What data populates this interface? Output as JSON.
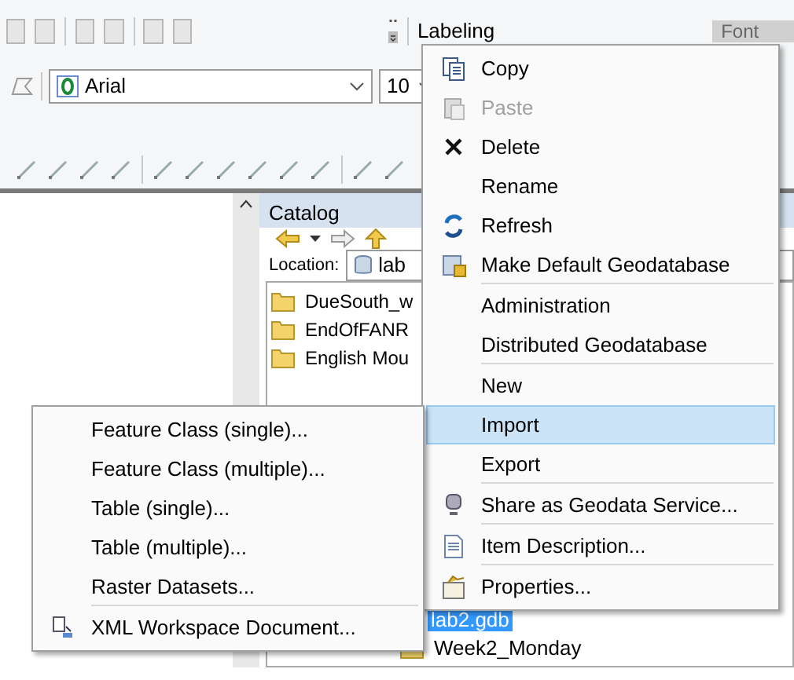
{
  "toolbar": {
    "labeling": "Labeling",
    "font_label": "Font",
    "font_name": "Arial",
    "font_size": "10"
  },
  "catalog": {
    "title": "Catalog",
    "location_label": "Location:",
    "location_value": "lab",
    "items": [
      {
        "label": "DueSouth_w",
        "selected": false
      },
      {
        "label": "EndOfFANR",
        "selected": false
      },
      {
        "label": "English Mou",
        "selected": false
      }
    ],
    "lower_items": [
      {
        "label": "lab2.gdb",
        "selected": true
      },
      {
        "label": "Week2_Monday",
        "selected": false
      }
    ]
  },
  "context_menu": [
    {
      "label": "Copy",
      "kind": "copy",
      "disabled": false,
      "selected": false,
      "divider": false
    },
    {
      "label": "Paste",
      "kind": "paste",
      "disabled": true,
      "selected": false,
      "divider": false
    },
    {
      "label": "Delete",
      "kind": "delete",
      "disabled": false,
      "selected": false,
      "divider": false
    },
    {
      "label": "Rename",
      "kind": "plain",
      "disabled": false,
      "selected": false,
      "divider": false
    },
    {
      "label": "Refresh",
      "kind": "refresh",
      "disabled": false,
      "selected": false,
      "divider": false
    },
    {
      "label": "Make Default Geodatabase",
      "kind": "database",
      "disabled": false,
      "selected": false,
      "divider": true
    },
    {
      "label": "Administration",
      "kind": "plain",
      "disabled": false,
      "selected": false,
      "divider": false
    },
    {
      "label": "Distributed Geodatabase",
      "kind": "plain",
      "disabled": false,
      "selected": false,
      "divider": true
    },
    {
      "label": "New",
      "kind": "plain",
      "disabled": false,
      "selected": false,
      "divider": false
    },
    {
      "label": "Import",
      "kind": "plain",
      "disabled": false,
      "selected": true,
      "divider": false
    },
    {
      "label": "Export",
      "kind": "plain",
      "disabled": false,
      "selected": false,
      "divider": true
    },
    {
      "label": "Share as Geodata Service...",
      "kind": "service",
      "disabled": false,
      "selected": false,
      "divider": true
    },
    {
      "label": "Item Description...",
      "kind": "document",
      "disabled": false,
      "selected": false,
      "divider": true
    },
    {
      "label": "Properties...",
      "kind": "properties",
      "disabled": false,
      "selected": false,
      "divider": false
    }
  ],
  "import_submenu": [
    {
      "label": "Feature Class (single)...",
      "kind": "plain",
      "divider": false
    },
    {
      "label": "Feature Class (multiple)...",
      "kind": "plain",
      "divider": false
    },
    {
      "label": "Table (single)...",
      "kind": "plain",
      "divider": false
    },
    {
      "label": "Table (multiple)...",
      "kind": "plain",
      "divider": false
    },
    {
      "label": "Raster Datasets...",
      "kind": "plain",
      "divider": true
    },
    {
      "label": "XML Workspace Document...",
      "kind": "xml",
      "divider": false
    }
  ]
}
